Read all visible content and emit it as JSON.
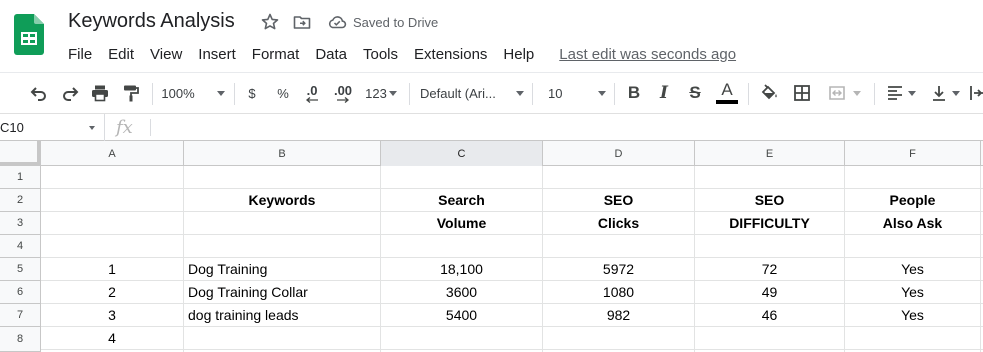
{
  "app": {
    "doc_title": "Keywords Analysis",
    "saved_status": "Saved to Drive",
    "menu": [
      "File",
      "Edit",
      "View",
      "Insert",
      "Format",
      "Data",
      "Tools",
      "Extensions",
      "Help"
    ],
    "last_edit": "Last edit was seconds ago",
    "brand_color": "#0F9D58"
  },
  "toolbar": {
    "zoom": "100%",
    "currency": "$",
    "percent": "%",
    "decrease_decimals": ".0",
    "increase_decimals": ".00",
    "more_formats": "123",
    "font": "Default (Ari...",
    "font_size": "10",
    "bold": "B",
    "italic": "I",
    "strikethrough": "S",
    "text_color_letter": "A",
    "icons": [
      "undo-icon",
      "redo-icon",
      "print-icon",
      "paint-format-icon",
      "fill-color-icon",
      "borders-icon",
      "merge-cells-icon",
      "horizontal-align-icon",
      "vertical-align-icon",
      "text-wrap-icon"
    ]
  },
  "formula_bar": {
    "cell_ref": "C10",
    "fx_label": "fx",
    "value": ""
  },
  "sheet": {
    "columns": [
      "A",
      "B",
      "C",
      "D",
      "E",
      "F"
    ],
    "active_column": "C",
    "rows": [
      "1",
      "2",
      "3",
      "4",
      "5",
      "6",
      "7",
      "8"
    ],
    "cells": {
      "B2": "Keywords",
      "C2": "Search",
      "C3": "Volume",
      "D2": "SEO",
      "D3": "Clicks",
      "E2": "SEO",
      "E3": "DIFFICULTY",
      "F2": "People",
      "F3": "Also Ask",
      "A5": "1",
      "B5": "Dog Training",
      "C5": "18,100",
      "D5": "5972",
      "E5": "72",
      "F5": "Yes",
      "A6": "2",
      "B6": "Dog Training Collar",
      "C6": "3600",
      "D6": "1080",
      "E6": "49",
      "F6": "Yes",
      "A7": "3",
      "B7": "dog training leads",
      "C7": "5400",
      "D7": "982",
      "E7": "46",
      "F7": "Yes",
      "A8": "4"
    }
  }
}
